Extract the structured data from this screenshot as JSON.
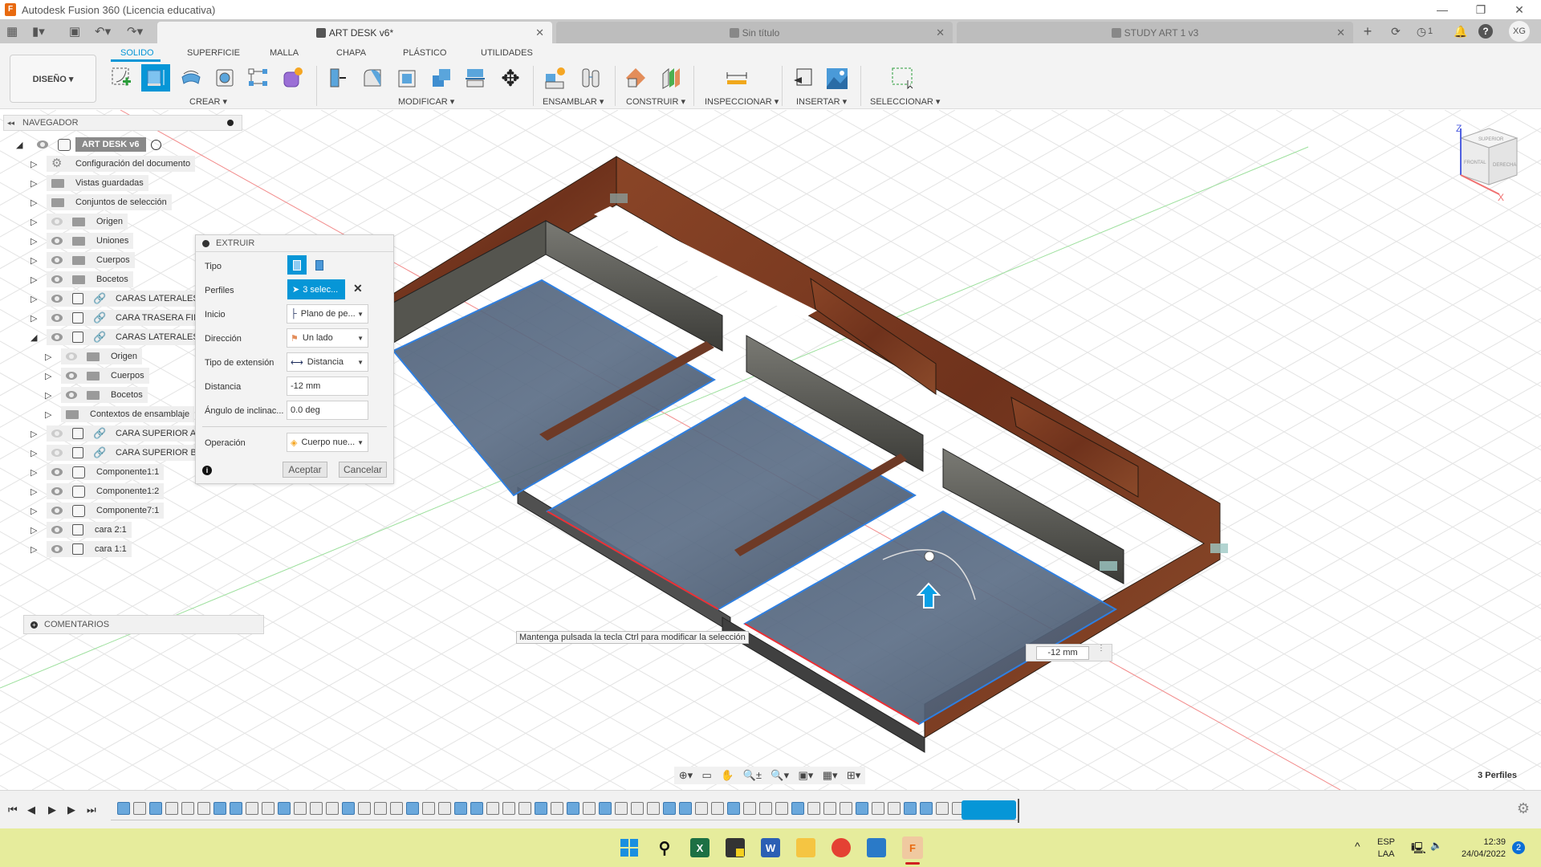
{
  "app": {
    "title": "Autodesk Fusion 360 (Licencia educativa)",
    "app_icon_letter": "F"
  },
  "window_controls": {
    "minimize": "—",
    "maximize": "❐",
    "close": "✕"
  },
  "quick_access": {
    "grid": "▦",
    "file": "▮▾",
    "save": "▣",
    "undo": "↶▾",
    "redo": "↷▾"
  },
  "tabs": [
    {
      "label": "ART DESK v6*",
      "active": true,
      "close": "✕"
    },
    {
      "label": "Sin título",
      "active": false,
      "close": "✕"
    },
    {
      "label": "STUDY ART 1 v3",
      "active": false,
      "close": "✕"
    }
  ],
  "right_icons": {
    "new_tab": "+",
    "extensions": "⟳",
    "jobs": "◷",
    "jobs_count": "1",
    "notifications": "🔔",
    "help": "?",
    "user_initials": "XG"
  },
  "ribbon": {
    "workspace": "DISEÑO ▾",
    "tabs": [
      "SOLIDO",
      "SUPERFICIE",
      "MALLA",
      "CHAPA",
      "PLÁSTICO",
      "UTILIDADES"
    ],
    "active_tab": "SOLIDO",
    "groups": [
      "CREAR ▾",
      "MODIFICAR ▾",
      "ENSAMBLAR ▾",
      "CONSTRUIR ▾",
      "INSPECCIONAR ▾",
      "INSERTAR ▾",
      "SELECCIONAR ▾"
    ]
  },
  "browser": {
    "header": "NAVEGADOR",
    "root": "ART DESK v6",
    "items": [
      {
        "label": "Configuración del documento",
        "icon": "gear",
        "eye": "none",
        "expand": "▷"
      },
      {
        "label": "Vistas guardadas",
        "icon": "folder",
        "eye": "none",
        "expand": "▷"
      },
      {
        "label": "Conjuntos de selección",
        "icon": "folder",
        "eye": "none",
        "expand": "▷"
      },
      {
        "label": "Origen",
        "icon": "folder",
        "eye": "off",
        "expand": "▷"
      },
      {
        "label": "Uniones",
        "icon": "folder",
        "eye": "on",
        "expand": "▷"
      },
      {
        "label": "Cuerpos",
        "icon": "folder",
        "eye": "on",
        "expand": "▷"
      },
      {
        "label": "Bocetos",
        "icon": "folder",
        "eye": "on",
        "expand": "▷"
      },
      {
        "label": "CARAS LATERALES",
        "icon": "body-link",
        "eye": "on",
        "expand": "▷"
      },
      {
        "label": "CARA TRASERA  FIN",
        "icon": "body-link",
        "eye": "on",
        "expand": "▷"
      },
      {
        "label": "CARAS LATERALES",
        "icon": "body-link",
        "eye": "on",
        "expand": "◢"
      },
      {
        "label": "Origen",
        "icon": "folder",
        "eye": "off",
        "expand": "▷",
        "indent": 1
      },
      {
        "label": "Cuerpos",
        "icon": "folder",
        "eye": "on",
        "expand": "▷",
        "indent": 1
      },
      {
        "label": "Bocetos",
        "icon": "folder",
        "eye": "on",
        "expand": "▷",
        "indent": 1
      },
      {
        "label": "Contextos de ensamblaje",
        "icon": "folder",
        "eye": "none",
        "expand": "▷",
        "indent": 1
      },
      {
        "label": "CARA SUPERIOR A v",
        "icon": "body-link",
        "eye": "off",
        "expand": "▷"
      },
      {
        "label": "CARA SUPERIOR B v",
        "icon": "body-link",
        "eye": "off",
        "expand": "▷"
      },
      {
        "label": "Componente1:1",
        "icon": "component",
        "eye": "on",
        "expand": "▷"
      },
      {
        "label": "Componente1:2",
        "icon": "component",
        "eye": "on",
        "expand": "▷"
      },
      {
        "label": "Componente7:1",
        "icon": "component",
        "eye": "on",
        "expand": "▷"
      },
      {
        "label": "cara 2:1",
        "icon": "body",
        "eye": "on",
        "expand": "▷"
      },
      {
        "label": "cara 1:1",
        "icon": "body",
        "eye": "on",
        "expand": "▷"
      }
    ]
  },
  "extrude_dialog": {
    "title": "EXTRUIR",
    "labels": {
      "tipo": "Tipo",
      "perfiles": "Perfiles",
      "inicio": "Inicio",
      "direccion": "Dirección",
      "tipo_extension": "Tipo de extensión",
      "distancia": "Distancia",
      "angulo": "Ángulo de inclinac...",
      "operacion": "Operación"
    },
    "values": {
      "perfiles": "3 selec...",
      "inicio": "Plano de pe...",
      "direccion": "Un lado",
      "tipo_extension": "Distancia",
      "distancia": "-12 mm",
      "angulo": "0.0 deg",
      "operacion": "Cuerpo nue..."
    },
    "clear": "✕",
    "accept": "Aceptar",
    "cancel": "Cancelar",
    "info": "i"
  },
  "comments": {
    "label": "COMENTARIOS"
  },
  "viewport": {
    "tooltip": "Mantenga pulsada la tecla Ctrl para modificar la selección",
    "dimension_value": "-12 mm",
    "status": "3 Perfiles",
    "viewcube": {
      "top": "SUPERIOR",
      "front": "FRONTAL",
      "right": "DERECHA",
      "axis_z": "Z",
      "axis_x": "X"
    },
    "colors": {
      "wood": "#7a3a22",
      "profile_fill": "#5a6b82",
      "selection_edge": "#2f7fe0",
      "accent": "#0696d7"
    }
  },
  "navbar_icons": [
    "orbit",
    "look-at",
    "pan",
    "zoom",
    "fit",
    "display",
    "grid",
    "viewports"
  ],
  "timeline": {
    "controls": [
      "⏮",
      "◀",
      "▶",
      "▶",
      "⏭"
    ],
    "settings": "⚙"
  },
  "taskbar": {
    "apps": [
      "start",
      "search",
      "excel",
      "sticky-notes",
      "word",
      "file-explorer",
      "chrome",
      "photos",
      "fusion-360"
    ],
    "language": "ESP",
    "layout": "LAA",
    "time": "12:39",
    "date": "24/04/2022",
    "notifications": "2",
    "chevron": "^"
  }
}
